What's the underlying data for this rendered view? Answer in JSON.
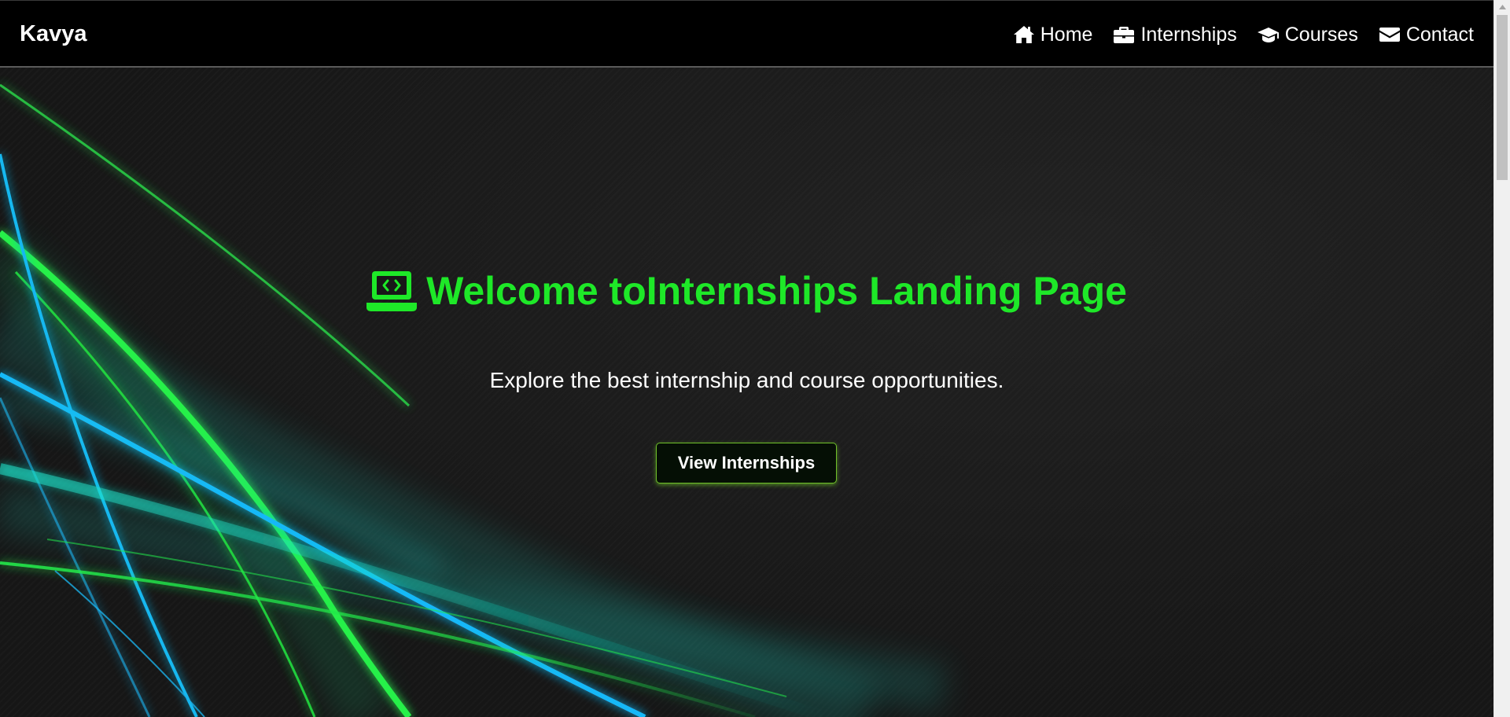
{
  "navbar": {
    "brand": "Kavya",
    "items": [
      {
        "label": "Home",
        "icon": "home-icon"
      },
      {
        "label": "Internships",
        "icon": "briefcase-icon"
      },
      {
        "label": "Courses",
        "icon": "graduation-cap-icon"
      },
      {
        "label": "Contact",
        "icon": "envelope-icon"
      }
    ]
  },
  "hero": {
    "icon": "laptop-code-icon",
    "title": "Welcome toInternships Landing Page",
    "subtitle": "Explore the best internship and course opportunities.",
    "cta_label": "View Internships"
  },
  "colors": {
    "accent_green": "#1ee828",
    "navbar_bg": "#000000",
    "hero_bg": "#181818",
    "button_border": "#6fbf2a",
    "light_cyan": "#12c8e8",
    "light_teal": "#18e0c8"
  }
}
